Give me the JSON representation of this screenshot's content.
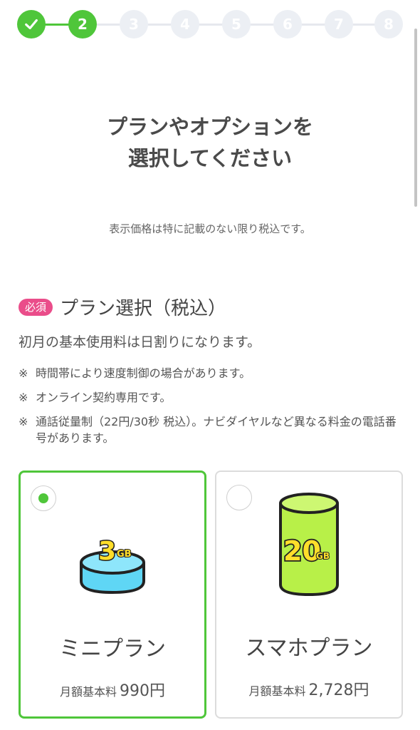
{
  "stepper": {
    "steps": [
      "",
      "2",
      "3",
      "4",
      "5",
      "6",
      "7",
      "8"
    ],
    "completed_icon": "check-icon",
    "current_step": 2
  },
  "title_line1": "プランやオプションを",
  "title_line2": "選択してください",
  "tax_note": "表示価格は特に記載のない限り税込です。",
  "section": {
    "badge": "必須",
    "title": "プラン選択（税込）",
    "description": "初月の基本使用料は日割りになります。",
    "notes": [
      {
        "mark": "※",
        "text": "時間帯により速度制御の場合があります。"
      },
      {
        "mark": "※",
        "text": "オンライン契約専用です。"
      },
      {
        "mark": "※",
        "text": "通話従量制（22円/30秒 税込）。ナビダイヤルなど異なる料金の電話番号があります。"
      }
    ]
  },
  "plans": [
    {
      "name": "ミニプラン",
      "price_label": "月額基本料",
      "price": "990円",
      "data_amount": "3",
      "data_unit": "GB",
      "selected": true
    },
    {
      "name": "スマホプラン",
      "price_label": "月額基本料",
      "price": "2,728円",
      "data_amount": "20",
      "data_unit": "GB",
      "selected": false
    }
  ],
  "colors": {
    "accent": "#4fc63a",
    "badge": "#ea4d8a",
    "mini_disc": "#5fd6f5",
    "smartphone_cylinder": "#b8f048",
    "data_label": "#ffde2a"
  }
}
